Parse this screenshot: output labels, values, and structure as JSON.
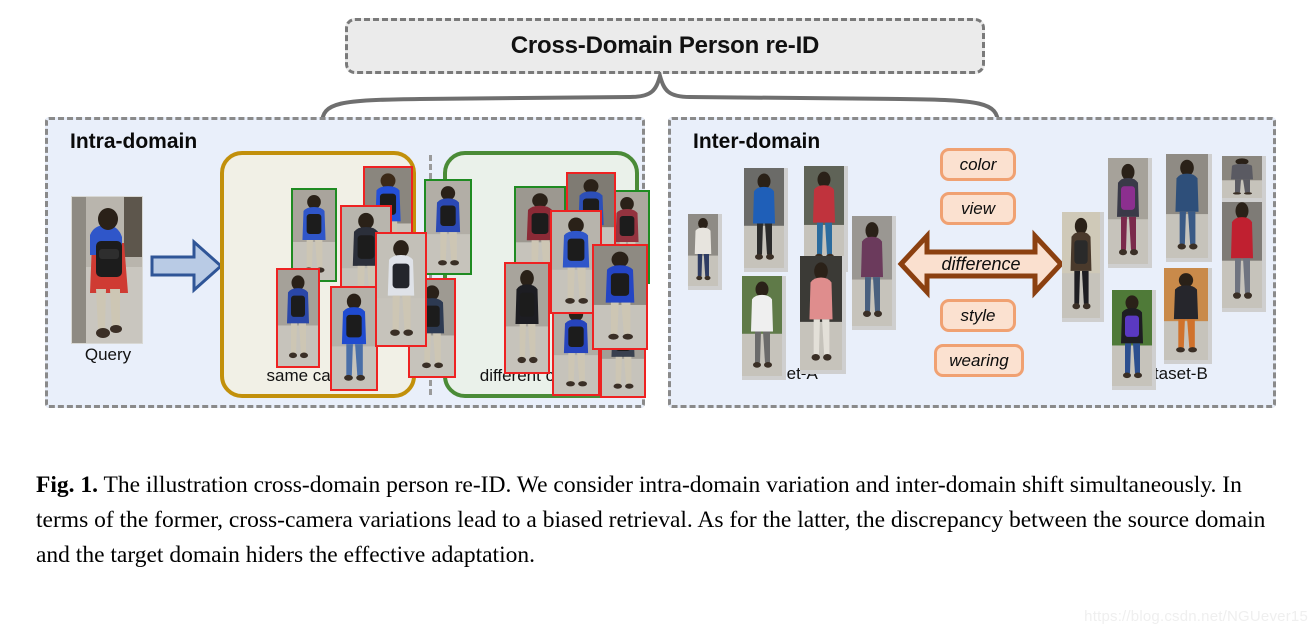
{
  "figure": {
    "title": "Cross-Domain Person re-ID",
    "caption_label": "Fig. 1.",
    "caption_text": " The illustration cross-domain person re-ID. We consider intra-domain variation and inter-domain shift simultaneously. In terms of the former, cross-camera variations lead to a biased retrieval. As for the latter, the discrepancy between the source domain and the target domain hiders the effective adaptation.",
    "watermark": "https://blog.csdn.net/NGUever15"
  },
  "colors": {
    "panel_bg": "#e9effa",
    "panel_border": "#8a8a8a",
    "title_bg": "#ebebeb",
    "title_border": "#7a7a7a",
    "same_camera_border": "#c2900b",
    "same_camera_bg": "#f1f0e6",
    "different_camera_border": "#4a8b37",
    "different_camera_bg": "#eaf1ea",
    "query_arrow_fill": "#b9cbe5",
    "query_arrow_stroke": "#2f5597",
    "difference_arrow_fill": "#fae0cf",
    "difference_arrow_stroke": "#8b4010",
    "tag_fill": "#fbe1d0",
    "tag_border": "#f0a172",
    "match_box_red": "#ee2222",
    "match_box_green": "#1f8b22",
    "brace": "#6f6f6f"
  },
  "intra_domain": {
    "title": "Intra-domain",
    "query_label": "Query",
    "arrow_name": "right-arrow",
    "groups": [
      {
        "label": "same camera"
      },
      {
        "label": "different camera"
      }
    ]
  },
  "inter_domain": {
    "title": "Inter-domain",
    "dataset_a_label": "Dataset-A",
    "dataset_b_label": "Dataset-B",
    "difference_label": "difference",
    "tags": [
      "color",
      "view",
      "style",
      "wearing"
    ]
  }
}
